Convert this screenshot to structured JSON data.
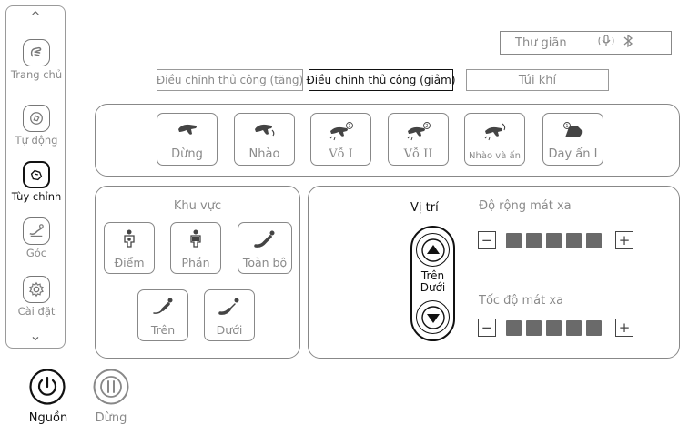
{
  "sidebar": {
    "up_arrow": "^",
    "down_arrow": "⌄",
    "items": [
      {
        "label": "Trang chủ",
        "icon": "hand-home-icon",
        "active": false
      },
      {
        "label": "Tự động",
        "icon": "hand-auto-icon",
        "active": false
      },
      {
        "label": "Tùy chỉnh",
        "icon": "hand-custom-icon",
        "active": true
      },
      {
        "label": "Góc",
        "icon": "recline-angle-icon",
        "active": false
      },
      {
        "label": "Cài đặt",
        "icon": "gear-icon",
        "active": false
      }
    ]
  },
  "status": {
    "mode": "Thư giãn",
    "icons": [
      "voice-icon",
      "bluetooth-icon"
    ]
  },
  "tabs": [
    {
      "label": "Điều chỉnh thủ công (tăng)",
      "active": false
    },
    {
      "label": "Điều chỉnh thủ công (giảm)",
      "active": true
    },
    {
      "label": "Túi khí",
      "active": false
    }
  ],
  "modes": [
    {
      "label": "Dừng",
      "icon": "hand-stop-icon"
    },
    {
      "label": "Nhào",
      "icon": "hand-knead-icon"
    },
    {
      "label": "Vỗ I",
      "icon": "hand-tap-1-icon"
    },
    {
      "label": "Vỗ II",
      "icon": "hand-tap-2-icon"
    },
    {
      "label": "Nhào và ấn",
      "icon": "hand-knead-press-icon"
    },
    {
      "label": "Day ấn I",
      "icon": "hand-press-1-icon"
    }
  ],
  "area": {
    "title": "Khu vực",
    "buttons": [
      {
        "label": "Điểm",
        "icon": "person-point-icon"
      },
      {
        "label": "Phần",
        "icon": "person-part-icon"
      },
      {
        "label": "Toàn bộ",
        "icon": "recline-full-icon"
      },
      {
        "label": "Trên",
        "icon": "recline-upper-icon"
      },
      {
        "label": "Dưới",
        "icon": "recline-lower-icon"
      }
    ]
  },
  "position": {
    "title": "Vị trí",
    "up_label": "Trên",
    "down_label": "Dưới"
  },
  "width": {
    "title": "Độ rộng mát xa",
    "minus": "−",
    "plus": "+",
    "level": 5,
    "max": 5
  },
  "speed": {
    "title": "Tốc độ mát xa",
    "minus": "−",
    "plus": "+",
    "level": 5,
    "max": 5
  },
  "power": {
    "label": "Nguồn"
  },
  "pause": {
    "label": "Dừng"
  }
}
